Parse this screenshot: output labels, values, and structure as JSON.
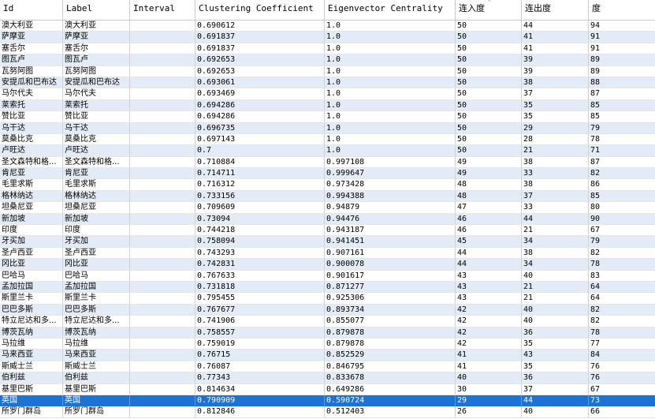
{
  "columns": [
    "Id",
    "Label",
    "Interval",
    "Clustering Coefficient",
    "Eigenvector Centrality",
    "连入度",
    "连出度",
    "度"
  ],
  "sort_indicator": "ˇ",
  "colors": {
    "alt_row": "#e3ebf6",
    "selected_row": "#1c73d6",
    "grid_line": "#d2d2d2"
  },
  "rows": [
    [
      "澳大利亚",
      "澳大利亚",
      "",
      "0.690612",
      "1.0",
      "50",
      "44",
      "94"
    ],
    [
      "萨摩亚",
      "萨摩亚",
      "",
      "0.691837",
      "1.0",
      "50",
      "41",
      "91"
    ],
    [
      "塞舌尔",
      "塞舌尔",
      "",
      "0.691837",
      "1.0",
      "50",
      "41",
      "91"
    ],
    [
      "图瓦卢",
      "图瓦卢",
      "",
      "0.692653",
      "1.0",
      "50",
      "39",
      "89"
    ],
    [
      "瓦努阿图",
      "瓦努阿图",
      "",
      "0.692653",
      "1.0",
      "50",
      "39",
      "89"
    ],
    [
      "安提瓜和巴布达",
      "安提瓜和巴布达",
      "",
      "0.693061",
      "1.0",
      "50",
      "38",
      "88"
    ],
    [
      "马尔代夫",
      "马尔代夫",
      "",
      "0.693469",
      "1.0",
      "50",
      "37",
      "87"
    ],
    [
      "莱索托",
      "莱索托",
      "",
      "0.694286",
      "1.0",
      "50",
      "35",
      "85"
    ],
    [
      "赞比亚",
      "赞比亚",
      "",
      "0.694286",
      "1.0",
      "50",
      "35",
      "85"
    ],
    [
      "乌干达",
      "乌干达",
      "",
      "0.696735",
      "1.0",
      "50",
      "29",
      "79"
    ],
    [
      "莫桑比克",
      "莫桑比克",
      "",
      "0.697143",
      "1.0",
      "50",
      "28",
      "78"
    ],
    [
      "卢旺达",
      "卢旺达",
      "",
      "0.7",
      "1.0",
      "50",
      "21",
      "71"
    ],
    [
      "圣文森特和格...",
      "圣文森特和格...",
      "",
      "0.710884",
      "0.997108",
      "49",
      "38",
      "87"
    ],
    [
      "肯尼亚",
      "肯尼亚",
      "",
      "0.714711",
      "0.999647",
      "49",
      "33",
      "82"
    ],
    [
      "毛里求斯",
      "毛里求斯",
      "",
      "0.716312",
      "0.973428",
      "48",
      "38",
      "86"
    ],
    [
      "格林纳达",
      "格林纳达",
      "",
      "0.733156",
      "0.994388",
      "48",
      "37",
      "85"
    ],
    [
      "坦桑尼亚",
      "坦桑尼亚",
      "",
      "0.709609",
      "0.94879",
      "47",
      "33",
      "80"
    ],
    [
      "新加坡",
      "新加坡",
      "",
      "0.73094",
      "0.94476",
      "46",
      "44",
      "90"
    ],
    [
      "印度",
      "印度",
      "",
      "0.744218",
      "0.943187",
      "46",
      "21",
      "67"
    ],
    [
      "牙买加",
      "牙买加",
      "",
      "0.758094",
      "0.941451",
      "45",
      "34",
      "79"
    ],
    [
      "圣卢西亚",
      "圣卢西亚",
      "",
      "0.743293",
      "0.907161",
      "44",
      "38",
      "82"
    ],
    [
      "冈比亚",
      "冈比亚",
      "",
      "0.742831",
      "0.900078",
      "44",
      "34",
      "78"
    ],
    [
      "巴哈马",
      "巴哈马",
      "",
      "0.767633",
      "0.901617",
      "43",
      "40",
      "83"
    ],
    [
      "孟加拉国",
      "孟加拉国",
      "",
      "0.731818",
      "0.871277",
      "43",
      "21",
      "64"
    ],
    [
      "斯里兰卡",
      "斯里兰卡",
      "",
      "0.795455",
      "0.925306",
      "43",
      "21",
      "64"
    ],
    [
      "巴巴多斯",
      "巴巴多斯",
      "",
      "0.767677",
      "0.893734",
      "42",
      "40",
      "82"
    ],
    [
      "特立尼达和多...",
      "特立尼达和多...",
      "",
      "0.741906",
      "0.855077",
      "42",
      "40",
      "82"
    ],
    [
      "博茨瓦纳",
      "博茨瓦纳",
      "",
      "0.758557",
      "0.879878",
      "42",
      "36",
      "78"
    ],
    [
      "马拉维",
      "马拉维",
      "",
      "0.759019",
      "0.879878",
      "42",
      "35",
      "77"
    ],
    [
      "马来西亚",
      "马来西亚",
      "",
      "0.76715",
      "0.852529",
      "41",
      "43",
      "84"
    ],
    [
      "斯威士兰",
      "斯威士兰",
      "",
      "0.76087",
      "0.846795",
      "41",
      "35",
      "76"
    ],
    [
      "伯利兹",
      "伯利兹",
      "",
      "0.77343",
      "0.833678",
      "40",
      "36",
      "76"
    ],
    [
      "基里巴斯",
      "基里巴斯",
      "",
      "0.814634",
      "0.649286",
      "30",
      "37",
      "67"
    ],
    [
      "英国",
      "英国",
      "",
      "0.790909",
      "0.590724",
      "29",
      "44",
      "73"
    ],
    [
      "所罗门群岛",
      "所罗门群岛",
      "",
      "0.812846",
      "0.512403",
      "26",
      "40",
      "66"
    ]
  ],
  "selected_row_index": 33
}
